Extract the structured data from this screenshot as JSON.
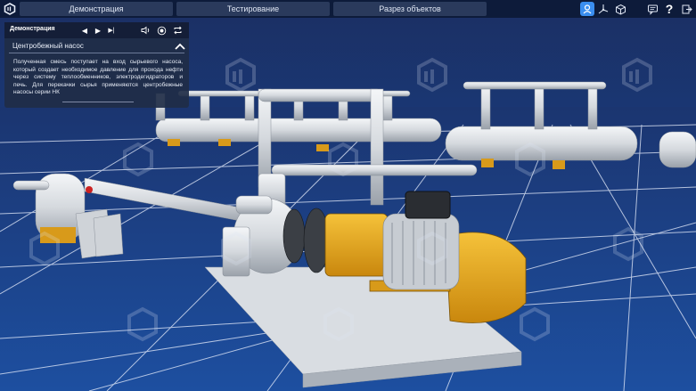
{
  "app": {
    "logo_icon": "app-logo-icon"
  },
  "tabs": [
    {
      "label": "Демонстрация"
    },
    {
      "label": "Тестирование"
    },
    {
      "label": "Разрез объектов"
    }
  ],
  "toolbar": {
    "icons": [
      "operator-icon",
      "axes-icon",
      "cube-icon",
      "chat-icon",
      "help-icon",
      "exit-icon"
    ],
    "help_label": "?"
  },
  "panel": {
    "title": "Демонстрация",
    "controls": {
      "prev": "◀",
      "play": "▶",
      "next": "▶|"
    },
    "section_title": "Центробежный насос",
    "description": "Полученная смесь поступает на вход сырьевого насоса, который создает необходимое давление для прохода нефти через систему теплообменников, электродегидраторов и печь. Для перекачки сырья применяются центробежные насосы серии НК"
  },
  "colors": {
    "accent": "#3a8ef0",
    "pump_yellow": "#e8a91a",
    "grid_line": "#ffffff",
    "floor": "#1c4b96"
  }
}
